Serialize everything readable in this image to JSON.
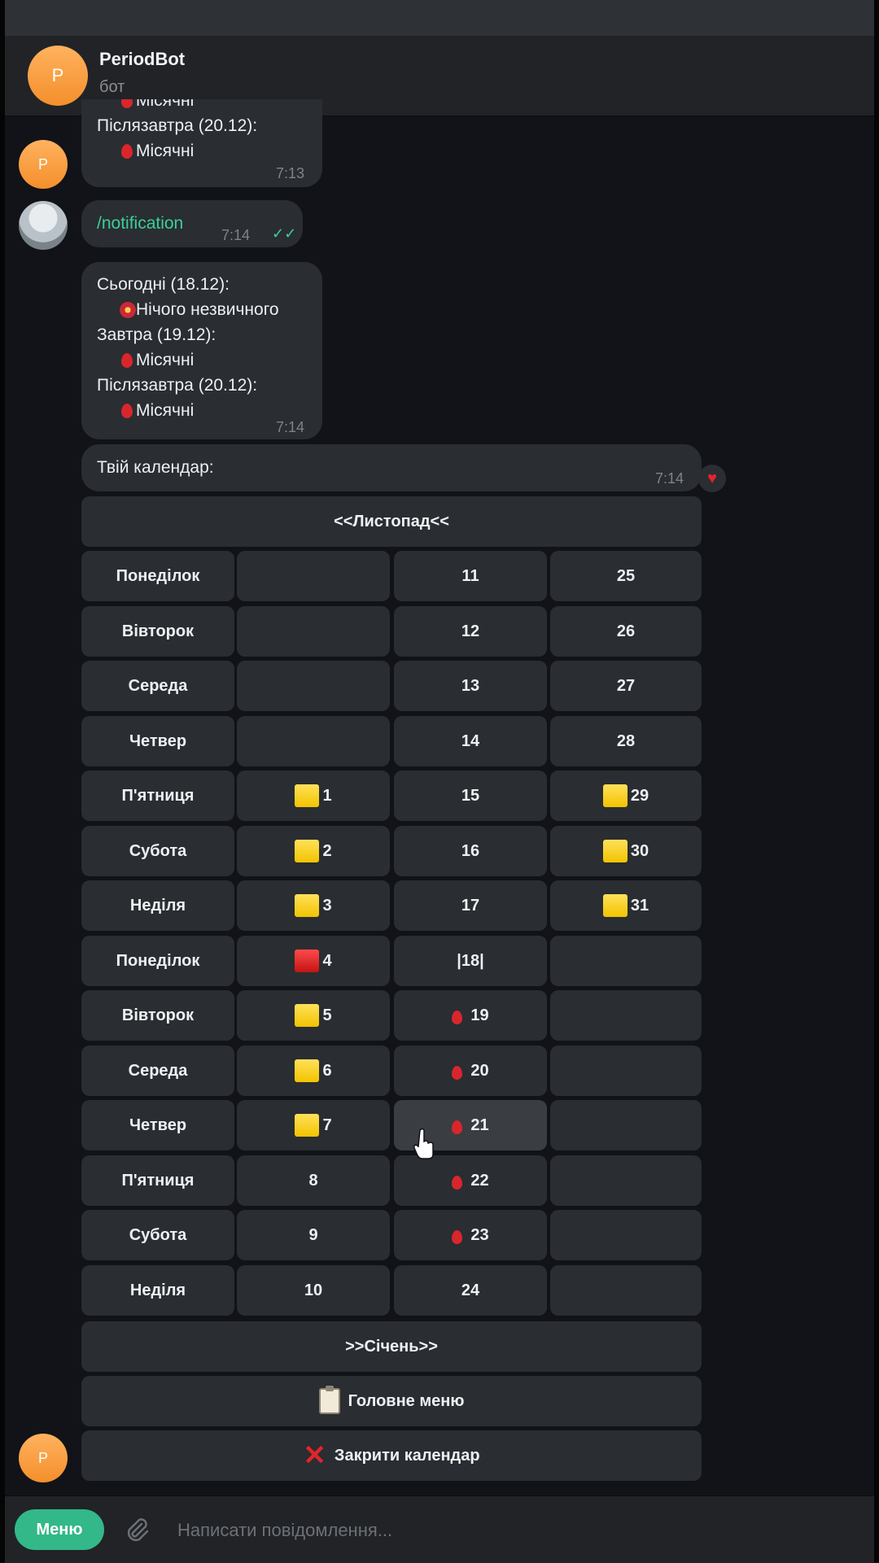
{
  "header": {
    "avatar_letter": "P",
    "title": "PeriodBot",
    "subtitle": "бот"
  },
  "messages": {
    "first": {
      "lines": [
        "Місячні",
        "Післязавтра (20.12):",
        "Місячні"
      ],
      "time": "7:13",
      "avatar_letter": "P"
    },
    "command": {
      "text": "/notification",
      "time": "7:14",
      "status": "read"
    },
    "notification": {
      "today": "Сьогодні (18.12):",
      "today_value": "Нічого незвичного",
      "tomorrow": "Завтра (19.12):",
      "tomorrow_value": "Місячні",
      "after_tomorrow": "Післязавтра (20.12):",
      "after_tomorrow_value": "Місячні",
      "time": "7:14"
    },
    "calendar": {
      "text": "Твій календар:",
      "time": "7:14",
      "reaction": "heart",
      "avatar_letter": "P"
    }
  },
  "keyboard": {
    "prev_month": "<<Листопад<<",
    "days": [
      "Понеділок",
      "Вівторок",
      "Середа",
      "Четвер",
      "П'ятниця",
      "Субота",
      "Неділя",
      "Понеділок",
      "Вівторок",
      "Середа",
      "Четвер",
      "П'ятниця",
      "Субота",
      "Неділя"
    ],
    "col1": [
      {
        "text": "",
        "mark": ""
      },
      {
        "text": "",
        "mark": ""
      },
      {
        "text": "",
        "mark": ""
      },
      {
        "text": "",
        "mark": ""
      },
      {
        "text": "1",
        "mark": "yellow"
      },
      {
        "text": "2",
        "mark": "yellow"
      },
      {
        "text": "3",
        "mark": "yellow"
      },
      {
        "text": "4",
        "mark": "red"
      },
      {
        "text": "5",
        "mark": "yellow"
      },
      {
        "text": "6",
        "mark": "yellow"
      },
      {
        "text": "7",
        "mark": "yellow"
      },
      {
        "text": "8",
        "mark": ""
      },
      {
        "text": "9",
        "mark": ""
      },
      {
        "text": "10",
        "mark": ""
      }
    ],
    "col2": [
      {
        "text": "11",
        "mark": ""
      },
      {
        "text": "12",
        "mark": ""
      },
      {
        "text": "13",
        "mark": ""
      },
      {
        "text": "14",
        "mark": ""
      },
      {
        "text": "15",
        "mark": ""
      },
      {
        "text": "16",
        "mark": ""
      },
      {
        "text": "17",
        "mark": ""
      },
      {
        "text": "|18|",
        "mark": ""
      },
      {
        "text": "19",
        "mark": "drop"
      },
      {
        "text": "20",
        "mark": "drop"
      },
      {
        "text": "21",
        "mark": "drop"
      },
      {
        "text": "22",
        "mark": "drop"
      },
      {
        "text": "23",
        "mark": "drop"
      },
      {
        "text": "24",
        "mark": ""
      }
    ],
    "col3": [
      {
        "text": "25",
        "mark": ""
      },
      {
        "text": "26",
        "mark": ""
      },
      {
        "text": "27",
        "mark": ""
      },
      {
        "text": "28",
        "mark": ""
      },
      {
        "text": "29",
        "mark": "yellow"
      },
      {
        "text": "30",
        "mark": "yellow"
      },
      {
        "text": "31",
        "mark": "yellow"
      },
      {
        "text": "",
        "mark": ""
      },
      {
        "text": "",
        "mark": ""
      },
      {
        "text": "",
        "mark": ""
      },
      {
        "text": "",
        "mark": ""
      },
      {
        "text": "",
        "mark": ""
      },
      {
        "text": "",
        "mark": ""
      },
      {
        "text": "",
        "mark": ""
      }
    ],
    "next_month": ">>Січень>>",
    "main_menu": "Головне меню",
    "close_calendar": "Закрити календар"
  },
  "input": {
    "menu_label": "Меню",
    "placeholder": "Написати повідомлення..."
  },
  "colors": {
    "accent": "#33b889",
    "background": "#111318",
    "bubble": "#2a2d31",
    "yellow_mark": "#f2c300",
    "red_mark": "#d9262c"
  }
}
